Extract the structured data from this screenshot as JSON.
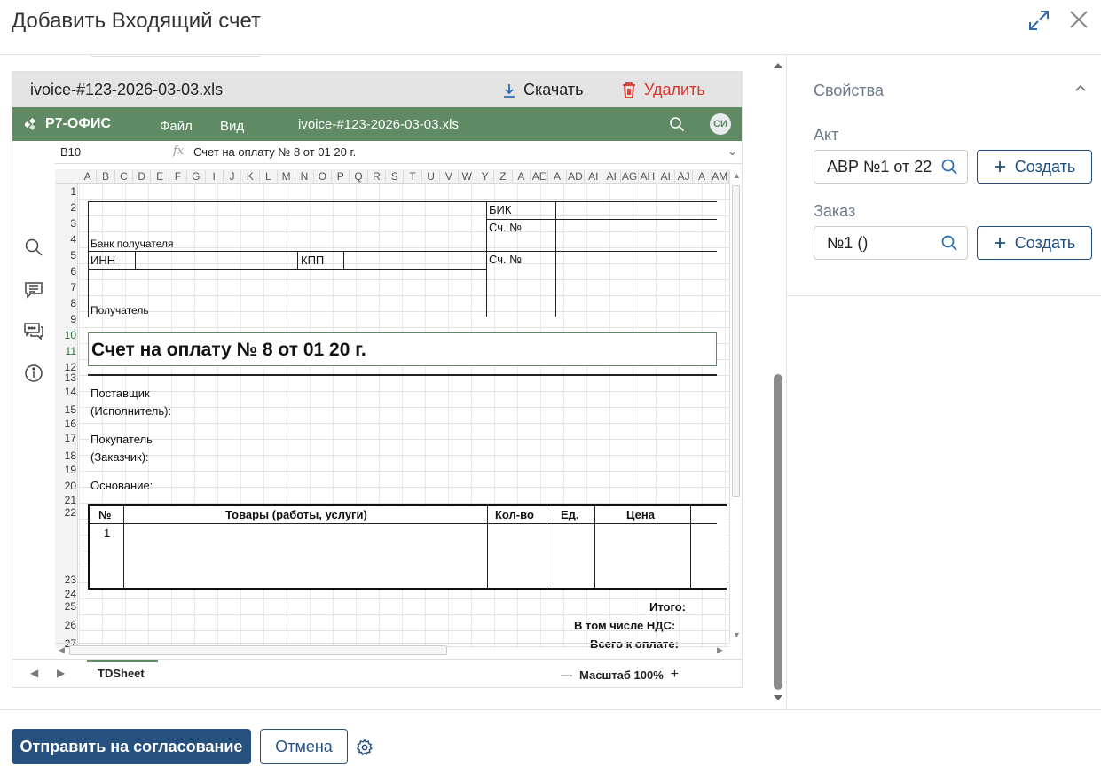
{
  "header": {
    "title": "Добавить Входящий счет"
  },
  "viewer": {
    "file_name": "ivoice-#123-2026-03-03.xls",
    "download_label": "Скачать",
    "delete_label": "Удалить",
    "app_name": "Р7-ОФИС",
    "menu": [
      "Файл",
      "Вид"
    ],
    "doc_title": "ivoice-#123-2026-03-03.xls",
    "avatar": "СИ",
    "cell_ref": "B10",
    "formula_value": "Счет на оплату № 8  от 01       20   г.",
    "columns": [
      "A",
      "B",
      "C",
      "D",
      "E",
      "F",
      "G",
      "I",
      "J",
      "K",
      "L",
      "M",
      "N",
      "O",
      "P",
      "Q",
      "R",
      "S",
      "T",
      "U",
      "V",
      "W",
      "Y",
      "Z",
      "A",
      "AE",
      "A",
      "AD",
      "AI",
      "AI",
      "AG",
      "AH",
      "AI",
      "AJ",
      "A",
      "AM"
    ],
    "rows": [
      "1",
      "2",
      "3",
      "4",
      "5",
      "6",
      "7",
      "8",
      "9",
      "10",
      "11",
      "12",
      "13",
      "14",
      "15",
      "16",
      "17",
      "18",
      "19",
      "20",
      "21",
      "22",
      "23",
      "24",
      "25",
      "26",
      "27"
    ],
    "sheet": {
      "bik": "БИК",
      "sch1": "Сч. №",
      "bank": "Банк получателя",
      "inn": "ИНН",
      "kpp": "КПП",
      "sch2": "Сч. №",
      "recipient": "Получатель",
      "heading": "Счет на оплату № 8  от 01       20   г.",
      "supplier_1": "Поставщик",
      "supplier_2": "(Исполнитель):",
      "buyer_1": "Покупатель",
      "buyer_2": "(Заказчик):",
      "basis": "Основание:",
      "th_no": "№",
      "th_goods": "Товары (работы, услуги)",
      "th_qty": "Кол-во",
      "th_unit": "Ед.",
      "th_price": "Цена",
      "row1": "1",
      "total": "Итого:",
      "vat": "В том числе НДС:",
      "to_pay": "Всего к оплате:"
    },
    "sheet_tab": "TDSheet",
    "zoom_label": "Масштаб 100%"
  },
  "properties": {
    "title": "Свойства",
    "act_label": "Акт",
    "act_value": "АВР №1 от 22",
    "order_label": "Заказ",
    "order_value": "№1 ()",
    "create_label": "Создать"
  },
  "footer": {
    "submit_label": "Отправить на согласование",
    "cancel_label": "Отмена"
  },
  "colors": {
    "primary": "#26517e",
    "r7_green": "#5f8a63",
    "delete_red": "#d9342b",
    "download_blue": "#2a6fb8"
  },
  "icons": [
    "expand-icon",
    "close-icon",
    "download-icon",
    "trash-icon",
    "search-icon",
    "comment-icon",
    "chat-icon",
    "info-icon",
    "gear-icon",
    "chevron-up-icon",
    "plus-icon"
  ]
}
